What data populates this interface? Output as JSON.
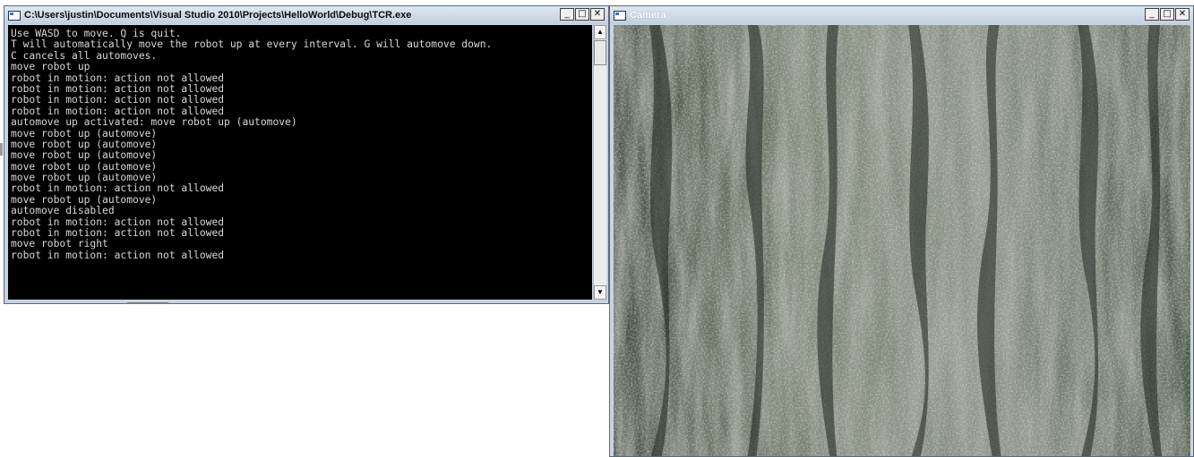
{
  "console_window": {
    "title": "C:\\Users\\justin\\Documents\\Visual Studio 2010\\Projects\\HelloWorld\\Debug\\TCR.exe",
    "lines": [
      "Use WASD to move. Q is quit.",
      "T will automatically move the robot up at every interval. G will automove down.",
      "C cancels all automoves.",
      "move robot up",
      "robot in motion: action not allowed",
      "robot in motion: action not allowed",
      "robot in motion: action not allowed",
      "robot in motion: action not allowed",
      "automove up activated: move robot up (automove)",
      "move robot up (automove)",
      "move robot up (automove)",
      "move robot up (automove)",
      "move robot up (automove)",
      "move robot up (automove)",
      "robot in motion: action not allowed",
      "move robot up (automove)",
      "automove disabled",
      "robot in motion: action not allowed",
      "robot in motion: action not allowed",
      "move robot right",
      "robot in motion: action not allowed"
    ],
    "colors": {
      "background": "#000000",
      "text": "#d8d8d8"
    }
  },
  "camera_window": {
    "title": "Camera"
  },
  "caption_buttons": {
    "minimize": "_",
    "maximize": "□",
    "close": "✕"
  },
  "scrollbar": {
    "up_arrow": "▲",
    "down_arrow": "▼"
  },
  "icons": {
    "console_app_icon": "console-app-icon",
    "camera_app_icon": "camera-app-icon"
  }
}
